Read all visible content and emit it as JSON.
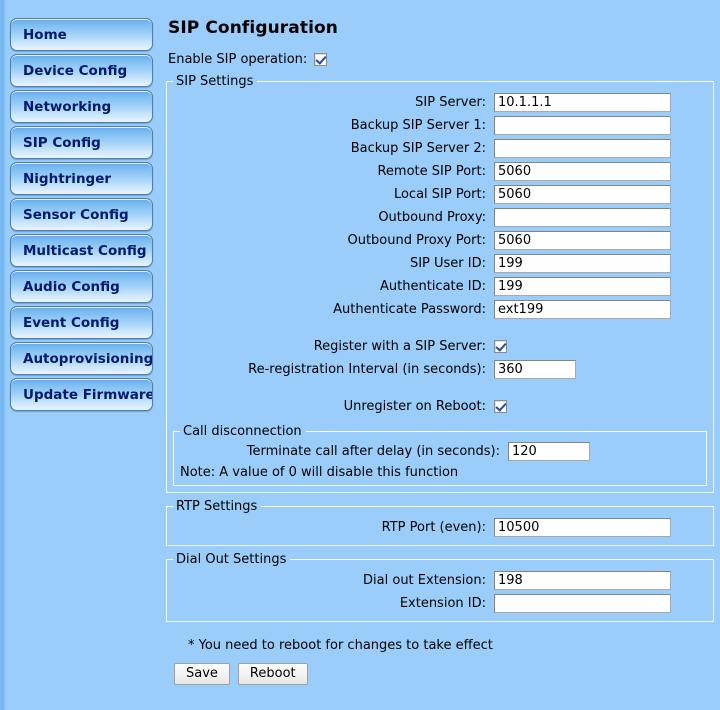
{
  "sidebar": {
    "items": [
      {
        "label": "Home",
        "name": "home"
      },
      {
        "label": "Device Config",
        "name": "device-config"
      },
      {
        "label": "Networking",
        "name": "networking"
      },
      {
        "label": "SIP Config",
        "name": "sip-config"
      },
      {
        "label": "Nightringer",
        "name": "nightringer"
      },
      {
        "label": "Sensor Config",
        "name": "sensor-config"
      },
      {
        "label": "Multicast Config",
        "name": "multicast-config"
      },
      {
        "label": "Audio Config",
        "name": "audio-config"
      },
      {
        "label": "Event Config",
        "name": "event-config"
      },
      {
        "label": "Autoprovisioning",
        "name": "autoprovisioning"
      },
      {
        "label": "Update Firmware",
        "name": "update-firmware"
      }
    ]
  },
  "main": {
    "title": "SIP Configuration",
    "enable_sip_label": "Enable SIP operation:",
    "enable_sip_checked": true,
    "sip_settings": {
      "legend": "SIP Settings",
      "fields": [
        {
          "label": "SIP Server:",
          "value": "10.1.1.1"
        },
        {
          "label": "Backup SIP Server 1:",
          "value": ""
        },
        {
          "label": "Backup SIP Server 2:",
          "value": ""
        },
        {
          "label": "Remote SIP Port:",
          "value": "5060"
        },
        {
          "label": "Local SIP Port:",
          "value": "5060"
        },
        {
          "label": "Outbound Proxy:",
          "value": ""
        },
        {
          "label": "Outbound Proxy Port:",
          "value": "5060"
        },
        {
          "label": "SIP User ID:",
          "value": "199"
        },
        {
          "label": "Authenticate ID:",
          "value": "199"
        },
        {
          "label": "Authenticate Password:",
          "value": "ext199"
        }
      ],
      "register_label": "Register with a SIP Server:",
      "register_checked": true,
      "reregistration_label": "Re-registration Interval (in seconds):",
      "reregistration_value": "360",
      "unregister_label": "Unregister on Reboot:",
      "unregister_checked": true,
      "call_disconnection": {
        "legend": "Call disconnection",
        "terminate_label": "Terminate call after delay (in seconds):",
        "terminate_value": "120",
        "note": "Note: A value of 0 will disable this function"
      }
    },
    "rtp_settings": {
      "legend": "RTP Settings",
      "fields": [
        {
          "label": "RTP Port (even):",
          "value": "10500"
        }
      ]
    },
    "dial_out_settings": {
      "legend": "Dial Out Settings",
      "fields": [
        {
          "label": "Dial out Extension:",
          "value": "198"
        },
        {
          "label": "Extension ID:",
          "value": ""
        }
      ]
    },
    "footnote": "* You need to reboot for changes to take effect",
    "save_label": "Save",
    "reboot_label": "Reboot"
  }
}
